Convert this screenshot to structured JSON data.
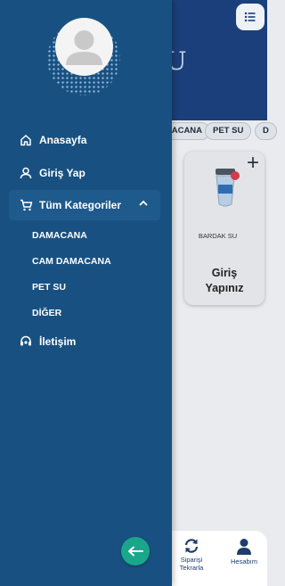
{
  "app": {
    "title_fragment": "U"
  },
  "categories_bar": [
    "ANACANA",
    "PET SU",
    "D"
  ],
  "product": {
    "name": "BARDAK SU",
    "action_line1": "Giriş",
    "action_line2": "Yapınız"
  },
  "bottom_nav": {
    "reorder_line1": "Siparişi",
    "reorder_line2": "Tekrarla",
    "account_label": "Hesabım"
  },
  "drawer": {
    "menu": {
      "home": "Anasayfa",
      "login": "Giriş Yap",
      "all_categories": "Tüm Kategoriler",
      "contact": "İletişim"
    },
    "subcategories": [
      "DAMACANA",
      "CAM DAMACANA",
      "PET SU",
      "DİĞER"
    ]
  },
  "icons": {
    "home": "home-icon",
    "login": "user-icon",
    "categories": "cart-icon",
    "contact": "headset-icon",
    "back": "arrow-left-icon",
    "reorder": "refresh-icon",
    "account": "person-icon",
    "list": "list-icon"
  },
  "colors": {
    "drawer_bg": "#185181",
    "header_bg": "#1a3f7a",
    "accent_green": "#18a78a"
  }
}
